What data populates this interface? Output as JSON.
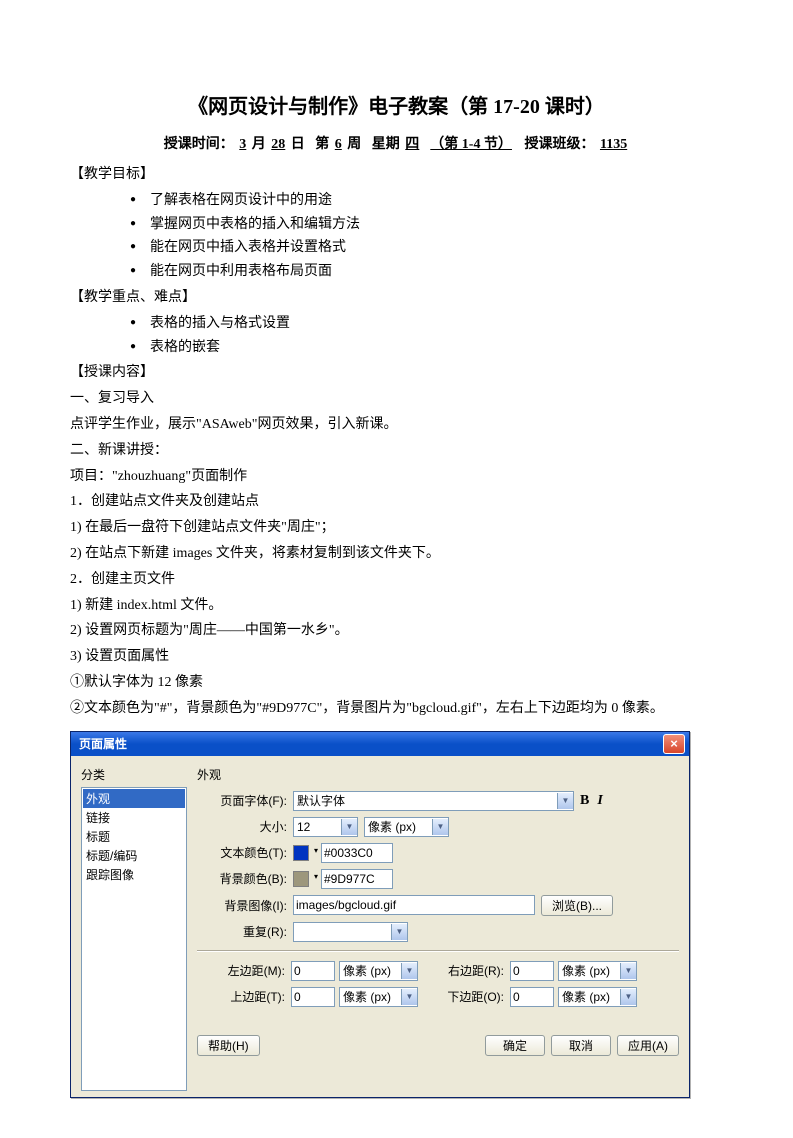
{
  "title": "《网页设计与制作》电子教案（第  17-20  课时）",
  "meta": {
    "prefix": "授课时间：",
    "month": "3",
    "month_suf": "月",
    "day": "28",
    "day_suf": "日",
    "week_pre": "第",
    "week": "6",
    "week_suf": "周",
    "weekday_pre": "星期",
    "weekday": "四",
    "periods": "（第 1-4 节）",
    "class_pre": "授课班级：",
    "class": "1135"
  },
  "h_goals": "【教学目标】",
  "goals": [
    "了解表格在网页设计中的用途",
    "掌握网页中表格的插入和编辑方法",
    "能在网页中插入表格并设置格式",
    "能在网页中利用表格布局页面"
  ],
  "h_focus": "【教学重点、难点】",
  "focus": [
    "表格的插入与格式设置",
    "表格的嵌套"
  ],
  "h_content": "【授课内容】",
  "c1": "一、复习导入",
  "c1_1": "点评学生作业，展示\"ASAweb\"网页效果，引入新课。",
  "c2": "二、新课讲授：",
  "c2_proj": "项目：\"zhouzhuang\"页面制作",
  "s1": "1．创建站点文件夹及创建站点",
  "s1_1": "1)   在最后一盘符下创建站点文件夹\"周庄\"；",
  "s1_2": "2)   在站点下新建 images 文件夹，将素材复制到该文件夹下。",
  "s2": "2．创建主页文件",
  "s2_1": "1)   新建 index.html 文件。",
  "s2_2": "2)   设置网页标题为\"周庄——中国第一水乡\"。",
  "s2_3": "3)   设置页面属性",
  "p1": "①默认字体为 12 像素",
  "p2": "②文本颜色为\"#\"，背景颜色为\"#9D977C\"，背景图片为\"bgcloud.gif\"，左右上下边距均为 0 像素。",
  "dialog": {
    "title": "页面属性",
    "close": "×",
    "cat_label": "分类",
    "cats": [
      "外观",
      "链接",
      "标题",
      "标题/编码",
      "跟踪图像"
    ],
    "group": "外观",
    "font_label": "页面字体(F):",
    "font_value": "默认字体",
    "bold": "B",
    "italic": "I",
    "size_label": "大小:",
    "size_value": "12",
    "size_unit": "像素 (px)",
    "textcolor_label": "文本颜色(T):",
    "textcolor_value": "#0033C0",
    "textcolor_swatch": "#0033C0",
    "bgcolor_label": "背景颜色(B):",
    "bgcolor_value": "#9D977C",
    "bgcolor_swatch": "#9D977C",
    "bgimg_label": "背景图像(I):",
    "bgimg_value": "images/bgcloud.gif",
    "browse": "浏览(B)...",
    "repeat_label": "重复(R):",
    "margin_left_l": "左边距(M):",
    "margin_right_l": "右边距(R):",
    "margin_top_l": "上边距(T):",
    "margin_bottom_l": "下边距(O):",
    "margin_val": "0",
    "margin_unit": "像素 (px)",
    "help": "帮助(H)",
    "ok": "确定",
    "cancel": "取消",
    "apply": "应用(A)"
  }
}
